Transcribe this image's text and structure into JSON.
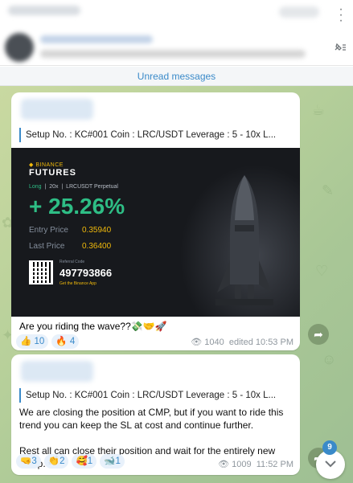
{
  "header": {
    "menu_icon": "more-vertical-icon"
  },
  "pinned": {
    "icon": "pin-list-icon"
  },
  "unread_label": "Unread messages",
  "messages": [
    {
      "reply_text": "Setup No. : KC#001  Coin        : LRC/USDT Leverage  : 5 - 10x L...",
      "card": {
        "brand_top": "◆ BINANCE",
        "brand_main": "FUTURES",
        "side": "Long",
        "leverage": "20x",
        "contract": "LRCUSDT Perpetual",
        "pnl": "+ 25.26%",
        "entry_label": "Entry Price",
        "entry_value": "0.35940",
        "last_label": "Last Price",
        "last_value": "0.36400",
        "referral_label": "Referral Code",
        "referral_code": "497793866",
        "app_text": "Get the Binance App"
      },
      "caption": "Are you riding the wave??💸🤝🚀",
      "reactions": [
        {
          "emoji": "👍",
          "count": "10"
        },
        {
          "emoji": "🔥",
          "count": "4"
        }
      ],
      "views": "1040",
      "edited_time": "edited 10:53 PM"
    },
    {
      "reply_text": "Setup No. : KC#001  Coin        : LRC/USDT Leverage  : 5 - 10x L...",
      "body": [
        "We are closing the position at CMP, but if you want to ride this trend you can keep the SL at cost and continue further.",
        "Rest all can close their position and wait for the entirely new setup."
      ],
      "reactions": [
        {
          "emoji": "🤜",
          "count": "3"
        },
        {
          "emoji": "👏",
          "count": "2"
        },
        {
          "emoji": "🥰",
          "count": "1"
        },
        {
          "emoji": "🐋",
          "count": "1"
        }
      ],
      "views": "1009",
      "time": "11:52 PM"
    }
  ],
  "unread_badge": "9",
  "colors": {
    "accent": "#3a8ac9",
    "profit": "#2ebd85",
    "binance_yellow": "#f0b90b"
  }
}
